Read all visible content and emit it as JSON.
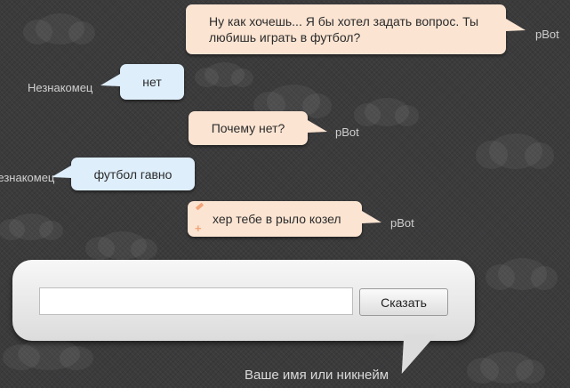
{
  "messages": [
    {
      "sender": "pBot",
      "text": "Ну как хочешь... Я бы хотел задать вопрос. Ты любишь играть в футбол?"
    },
    {
      "sender": "Незнакомец",
      "text": "нет"
    },
    {
      "sender": "pBot",
      "text": "Почему нет?"
    },
    {
      "sender": "Незнакомец",
      "text": "футбол гавно"
    },
    {
      "sender": "pBot",
      "text": "хер тебе в рыло козел"
    }
  ],
  "input": {
    "value": "",
    "placeholder": ""
  },
  "say_button_label": "Сказать",
  "nickname_label": "Ваше имя или никнейм",
  "colors": {
    "background": "#3b3b3c",
    "bot_bubble": "#fbe4d2",
    "user_bubble": "#deeefb",
    "panel": "#f0f0f0",
    "name_text": "#cfcfcf",
    "icon_orange": "#f2a67a"
  },
  "icons": [
    "pencil-icon",
    "plus-icon"
  ]
}
